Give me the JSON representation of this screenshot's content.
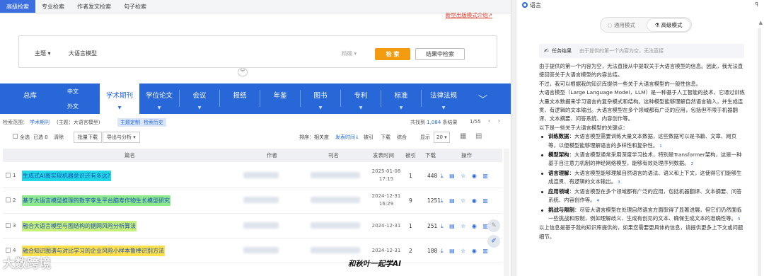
{
  "tabs": [
    "高级检索",
    "专业检索",
    "作者发文检索",
    "句子检索"
  ],
  "search": {
    "adv_link": "新型出版模式介绍↗",
    "field": "主题",
    "query": "大语言模型",
    "option": "精确",
    "search_button": "检 索",
    "result_button": "结果中检索"
  },
  "categories": {
    "zongku": "总库",
    "zh": "中文",
    "en": "外文",
    "items": [
      "学术期刊",
      "学位论文",
      "会议",
      "报纸",
      "年鉴",
      "图书",
      "专利",
      "标准",
      "法律法规"
    ]
  },
  "filter": {
    "scope_label": "检索范围：",
    "scope_value": "学术期刊",
    "query": "(主题：大语言模型)",
    "topic_btn": "主题定制",
    "history_btn": "检索历史",
    "total_prefix": "共找到",
    "total": "1,084",
    "total_suffix": "条结果",
    "page": "1/55"
  },
  "toolbar": {
    "select_all": "全选",
    "selected": "已选 0",
    "clear": "清除",
    "batch": "批量下载",
    "export": "导出与分析 ▾",
    "sort_label": "排序：",
    "sort_relevance": "相关度",
    "sort_date": "发表时间↓",
    "sort_cite": "被引",
    "sort_dl": "下载",
    "sort_all": "综合",
    "show_label": "显示",
    "show_value": "20"
  },
  "table": {
    "headers": [
      "篇名",
      "作者",
      "刊名",
      "发表时间",
      "被引",
      "下载",
      "操作"
    ],
    "rows": [
      {
        "n": "1",
        "title": "生成式AI离实现机器意识还有多远?",
        "date1": "2025-01-08",
        "date2": "17:15",
        "cite": "1",
        "dl": "448"
      },
      {
        "n": "2",
        "title": "基于大语言模型推理的数字孪生平台脑寿作物生长模型研究",
        "date1": "2024-12-31",
        "date2": "16:29",
        "cite": "9",
        "dl": "1251"
      },
      {
        "n": "3",
        "title": "融合大语言模型与图结构的据网风险分析算法",
        "date1": "2024-12-31",
        "date2": "",
        "cite": "1",
        "dl": "251"
      },
      {
        "n": "4",
        "title": "融合知识图谱与对比学习的企业风险小样本鲁棒识别方法",
        "date1": "2024-12-31",
        "date2": "",
        "cite": "2",
        "dl": "188"
      }
    ],
    "ops": "⤓ ▤ ☆ ◉ ▥"
  },
  "watermark": {
    "logo": "大数跨境",
    "caption": "和秋叶一起学AI"
  },
  "panel": {
    "title": "语言",
    "pin": "ꟼ",
    "mode_basic": "通用模式",
    "mode_adv": "高级模式",
    "task_label": "任务结果",
    "task_text": "由于提供的第一个内容为空，无法直接",
    "paras": [
      "由于提供的第一个内容为空，无法直接从中提取关于大语言模型的信息。因此，我无法直接回答关于大语言模型的内容总结。",
      "不过，我可以根据我的知识库提供一些关于大语言模型的一般性信息。",
      "大语言模型（Large Language Model，LLM）是一种基于人工智能的技术，它通过训练大量文本数据来学习语言的复杂模式和结构。这种模型能够理解自然语言输入，并生成连贯、有逻辑的文本输出。大语言模型在多个领域都有广泛的应用，包括但不限于机器翻译、文本摘要、问答系统、内容创作等。",
      "以下是一些关于大语言模型的关键点："
    ],
    "points": [
      {
        "k": "训练数据",
        "v": "：大语言模型需要训练大量文本数据，这些数据可以是书籍、文章、网页等，以便模型能够理解语言的多样性和复杂性。",
        "r": "1"
      },
      {
        "k": "模型架构",
        "v": "：大语言模型通常采用深度学习技术，特别是Transformer架构，这是一种基于自注意力机制的神经网络模型，能够有效处理序列数据。",
        "r": "2"
      },
      {
        "k": "语言理解",
        "v": "：大语言模型能够理解自然语言的语法、语义和上下文，这使得它们能够生成连贯、有逻辑的文本输出。",
        "r": "3"
      },
      {
        "k": "应用领域",
        "v": "：大语言模型在多个领域都有广泛的应用，包括机器翻译、文本摘要、问答系统、内容创作等。",
        "r": "4"
      },
      {
        "k": "挑战与限制",
        "v": "：尽管大语言模型在处理自然语言方面取得了显著进展，但它们仍然面临一些挑战和限制，例如理解歧义、生成有创见的文本、确保生成文本的准确性等。",
        "r": "5"
      }
    ],
    "closing": "以上信息是基于我的知识库提供的，如果您需要更具体的信息，请提供更多上下文或问题细节。"
  }
}
